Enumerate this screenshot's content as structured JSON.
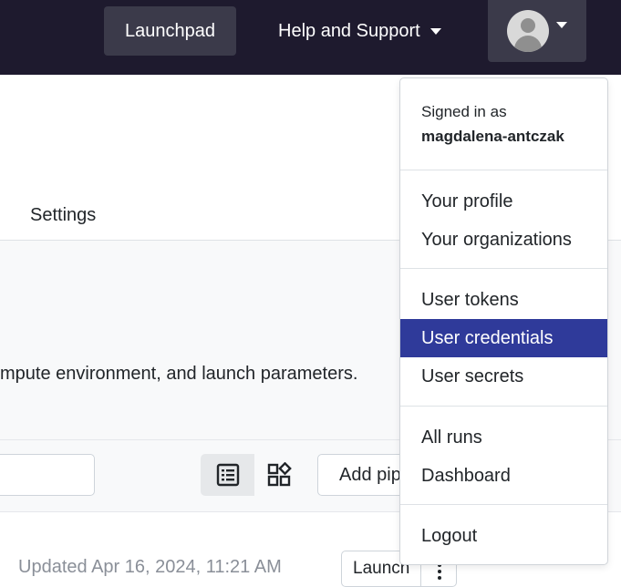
{
  "navbar": {
    "launchpad_label": "Launchpad",
    "help_label": "Help and Support"
  },
  "page": {
    "settings_tab": "Settings",
    "description": "mpute environment, and launch parameters.",
    "add_button_label": "Add pip",
    "updated_text": "Updated Apr 16, 2024, 11:21 AM",
    "launch_label": "Launch"
  },
  "user_menu": {
    "signed_in_label": "Signed in as",
    "username": "magdalena-antczak",
    "items": {
      "profile": "Your profile",
      "organizations": "Your organizations",
      "tokens": "User tokens",
      "credentials": "User credentials",
      "secrets": "User secrets",
      "runs": "All runs",
      "dashboard": "Dashboard",
      "logout": "Logout"
    },
    "active_item": "User credentials"
  },
  "colors": {
    "navbar_bg": "#1e1a2e",
    "active_item_bg": "#2f3a9a"
  }
}
